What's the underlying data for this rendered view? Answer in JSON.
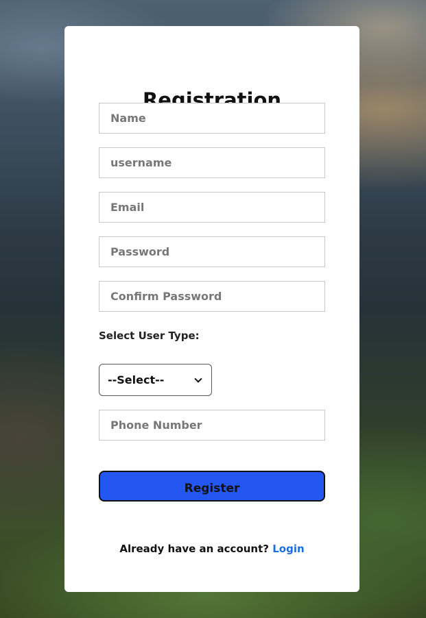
{
  "form": {
    "title": "Registration",
    "fields": {
      "name_placeholder": "Name",
      "username_placeholder": "username",
      "email_placeholder": "Email",
      "password_placeholder": "Password",
      "confirm_password_placeholder": "Confirm Password",
      "phone_placeholder": "Phone Number"
    },
    "user_type_label": "Select User Type:",
    "user_type_selected": "--Select--",
    "register_label": "Register",
    "footer_text": "Already have an account?",
    "login_link": "Login"
  },
  "colors": {
    "button": "#2456f2",
    "link": "#1a6fe0",
    "card": "#ffffff"
  },
  "icons": {
    "select": "chevron-down-icon"
  }
}
